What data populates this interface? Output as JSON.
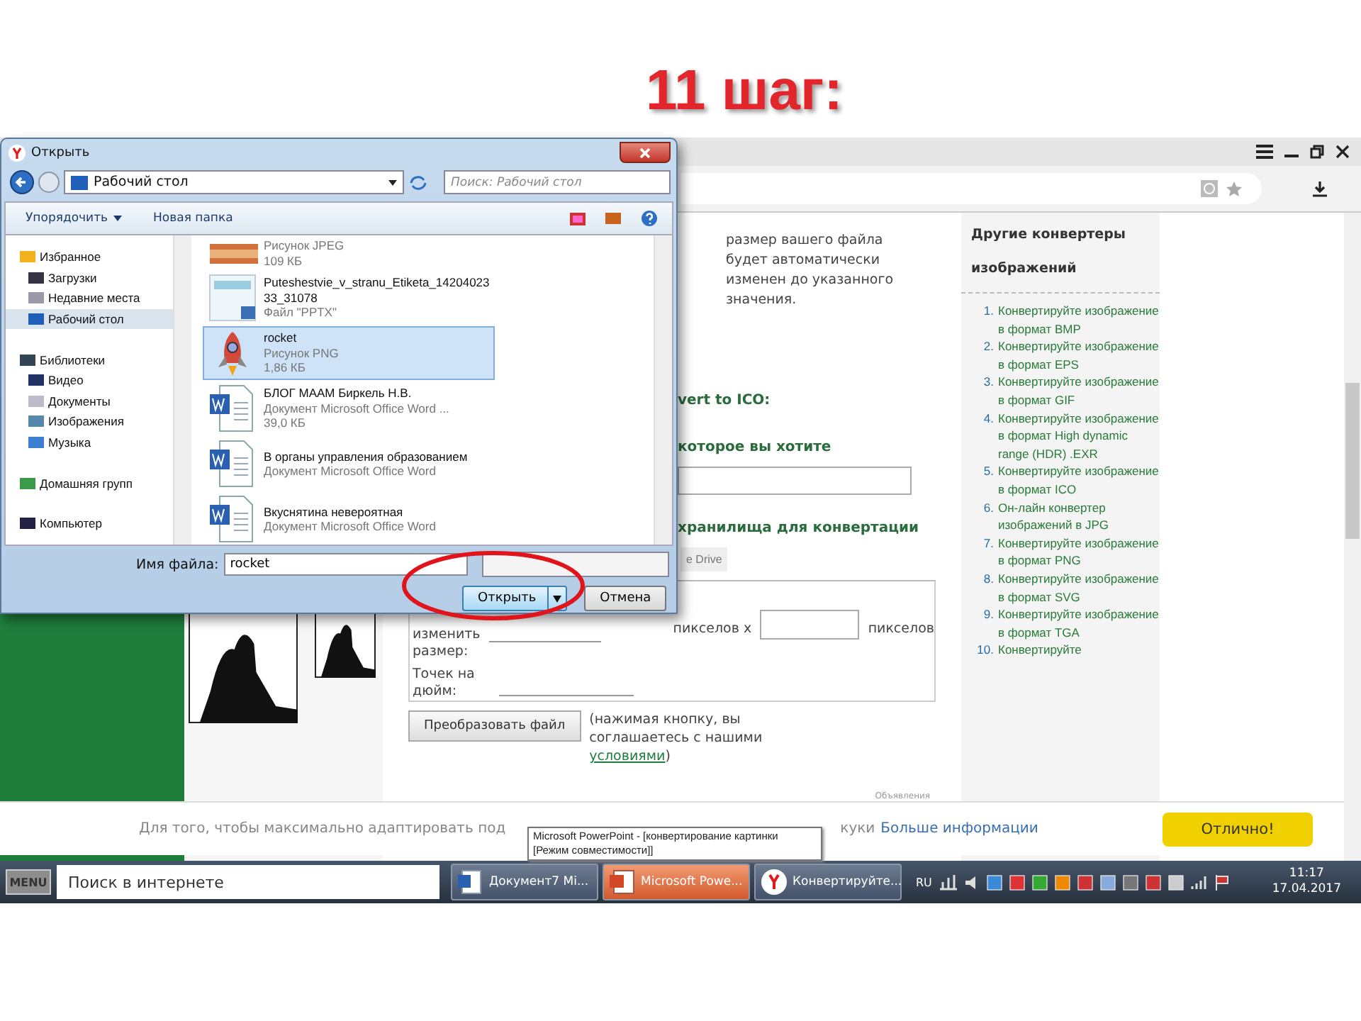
{
  "slide_title": "11 шаг:",
  "browser": {
    "page": {
      "intro": "размер вашего файла будет автоматически изменен до указанного значения.",
      "heading_1": "vert to ICO:",
      "heading_2": "которое вы хотите",
      "heading_3": "хранилища для конвертации",
      "drive_button": "e Drive",
      "resize_label": "изменить размер:",
      "pixels_x": "пикселов x",
      "pixels": "пикселов",
      "dpi_label": "Точек на дюйм:",
      "convert_button": "Преобразовать файл",
      "consent_text": "(нажимая кнопку, вы соглашаетесь с нашими",
      "consent_link": "условиями",
      "consent_end": ")",
      "ads_label": "Объявления"
    },
    "sidebar": {
      "title": "Другие конвертеры изображений",
      "items": [
        {
          "number": "1.",
          "text": "Конвертируйте изображение в формат BMP"
        },
        {
          "number": "2.",
          "text": "Конвертируйте изображение в формат EPS"
        },
        {
          "number": "3.",
          "text": "Конвертируйте изображение в формат GIF"
        },
        {
          "number": "4.",
          "text": "Конвертируйте изображение в формат High dynamic range (HDR) .EXR"
        },
        {
          "number": "5.",
          "text": "Конвертируйте изображение в формат ICO"
        },
        {
          "number": "6.",
          "text": "Он-лайн конвертер изображений в JPG"
        },
        {
          "number": "7.",
          "text": "Конвертируйте изображение в формат PNG"
        },
        {
          "number": "8.",
          "text": "Конвертируйте изображение в формат SVG"
        },
        {
          "number": "9.",
          "text": "Конвертируйте изображение в формат TGA"
        },
        {
          "number": "10.",
          "text": "Конвертируйте"
        }
      ]
    },
    "cookie_bar": {
      "text": "Для того, чтобы максимально адаптировать под",
      "text_end": "куки",
      "link": "Больше информации",
      "button": "Отлично!"
    }
  },
  "dialog": {
    "title": "Открыть",
    "location": "Рабочий стол",
    "search_placeholder": "Поиск: Рабочий стол",
    "toolbar": [
      "Упорядочить",
      "Новая папка"
    ],
    "nav": [
      {
        "label": "Избранное",
        "kind": "favorites",
        "selected": false,
        "children": [
          {
            "label": "Загрузки",
            "kind": "downloads",
            "selected": false
          },
          {
            "label": "Недавние места",
            "kind": "recent",
            "selected": false
          },
          {
            "label": "Рабочий стол",
            "kind": "desktop",
            "selected": true
          }
        ]
      },
      {
        "label": "Библиотеки",
        "kind": "libraries",
        "selected": false,
        "children": [
          {
            "label": "Видео",
            "kind": "video",
            "selected": false
          },
          {
            "label": "Документы",
            "kind": "documents",
            "selected": false
          },
          {
            "label": "Изображения",
            "kind": "pictures",
            "selected": false
          },
          {
            "label": "Музыка",
            "kind": "music",
            "selected": false
          }
        ]
      },
      {
        "label": "Домашняя групп",
        "kind": "homegroup",
        "selected": false
      },
      {
        "label": "Компьютер",
        "kind": "computer",
        "selected": false
      }
    ],
    "files": [
      {
        "kind": "photo",
        "type": "Рисунок JPEG",
        "size": "109 КБ",
        "selected": false
      },
      {
        "kind": "slides",
        "name": "Puteshestvie_v_stranu_Etiketa_1420402333_31078",
        "type": "Файл \"PPTX\"",
        "selected": false
      },
      {
        "kind": "rocket",
        "name": "rocket",
        "type": "Рисунок PNG",
        "size": "1,86 КБ",
        "selected": true
      },
      {
        "kind": "word",
        "name": "БЛОГ МААМ Биркель Н.В.",
        "type": "Документ Microsoft Office Word ...",
        "size": "39,0 КБ",
        "selected": false
      },
      {
        "kind": "word",
        "name": "В органы управления образованием",
        "type": "Документ Microsoft Office Word",
        "selected": false
      },
      {
        "kind": "word",
        "name": "Вкуснятина невероятная",
        "type": "Документ Microsoft Office Word",
        "selected": false
      }
    ],
    "filename_label": "Имя файла:",
    "filename": "rocket",
    "buttons": [
      "Открыть",
      "Отмена"
    ]
  },
  "tooltip": "Microsoft PowerPoint - [конвертирование картинки [Режим совместимости]]",
  "taskbar": {
    "menu": "MENU",
    "search_placeholder": "Поиск в интернете",
    "tasks": [
      {
        "label": "Документ7  Mi...",
        "kind": "word",
        "selected": false
      },
      {
        "label": "Microsoft Powe...",
        "kind": "powerpoint",
        "selected": true
      },
      {
        "label": "Конвертируйте...",
        "kind": "browser",
        "selected": false
      }
    ],
    "language": "RU",
    "time": "11:17",
    "date": "17.04.2017"
  }
}
